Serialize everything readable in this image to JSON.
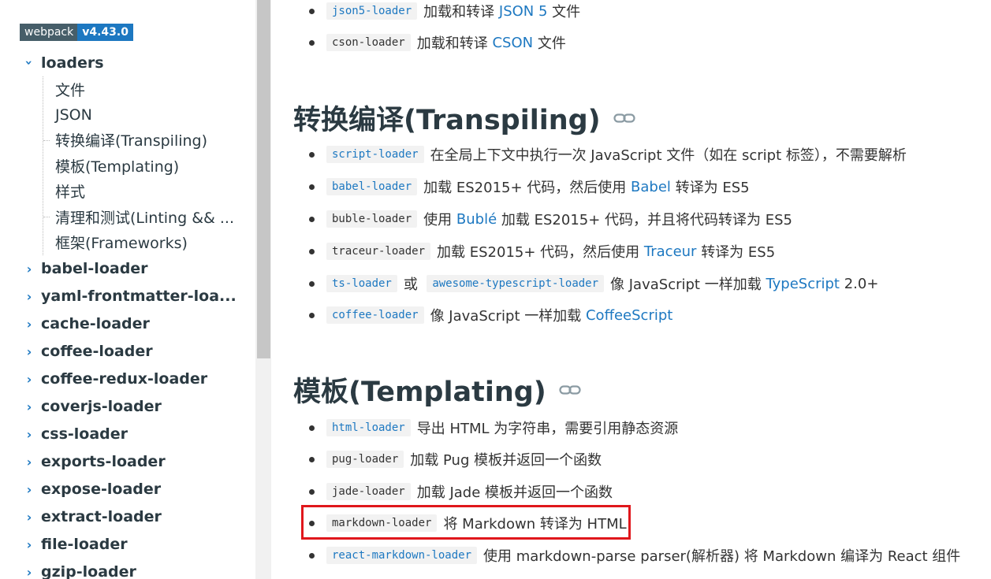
{
  "sidebar": {
    "badge": {
      "name": "webpack",
      "version": "v4.43.0"
    },
    "expanded": {
      "label": "loaders",
      "children": [
        "文件",
        "JSON",
        "转换编译(Transpiling)",
        "模板(Templating)",
        "样式",
        "清理和测试(Linting && ...",
        "框架(Frameworks)"
      ]
    },
    "items": [
      "babel-loader",
      "yaml-frontmatter-loa...",
      "cache-loader",
      "coffee-loader",
      "coffee-redux-loader",
      "coverjs-loader",
      "css-loader",
      "exports-loader",
      "expose-loader",
      "extract-loader",
      "file-loader",
      "gzip-loader"
    ]
  },
  "content": {
    "top_bullets": [
      {
        "code": "json5-loader",
        "pre": "加载和转译",
        "link": "JSON 5",
        "post": "文件"
      },
      {
        "code": "cson-loader",
        "pre": "加载和转译",
        "link": "CSON",
        "post": "文件"
      }
    ],
    "transpiling": {
      "title": "转换编译(Transpiling)",
      "items": {
        "script": {
          "code": "script-loader",
          "text": "在全局上下文中执行一次 JavaScript 文件（如在 script 标签），不需要解析"
        },
        "babel": {
          "code": "babel-loader",
          "pre": "加载 ES2015+ 代码，然后使用",
          "link": "Babel",
          "post": "转译为 ES5"
        },
        "buble": {
          "code": "buble-loader",
          "pre": "使用",
          "link": "Bublé",
          "post": "加载 ES2015+ 代码，并且将代码转译为 ES5"
        },
        "traceur": {
          "code": "traceur-loader",
          "pre": "加载 ES2015+ 代码，然后使用",
          "link": "Traceur",
          "post": "转译为 ES5"
        },
        "ts": {
          "code": "ts-loader",
          "or": "或",
          "code2": "awesome-typescript-loader",
          "pre": "像 JavaScript 一样加载",
          "link": "TypeScript",
          "post": "2.0+"
        },
        "coffee": {
          "code": "coffee-loader",
          "pre": "像 JavaScript 一样加载",
          "link": "CoffeeScript"
        }
      }
    },
    "templating": {
      "title": "模板(Templating)",
      "items": {
        "html": {
          "code": "html-loader",
          "text": "导出 HTML 为字符串，需要引用静态资源"
        },
        "pug": {
          "code": "pug-loader",
          "text": "加载 Pug 模板并返回一个函数"
        },
        "jade": {
          "code": "jade-loader",
          "text": "加载 Jade 模板并返回一个函数"
        },
        "markdown": {
          "code": "markdown-loader",
          "text": "将 Markdown 转译为 HTML"
        },
        "react_markdown": {
          "code": "react-markdown-loader",
          "text": "使用 markdown-parse parser(解析器) 将 Markdown 编译为 React 组件"
        }
      }
    }
  },
  "colors": {
    "link": "#1d78c1",
    "highlight": "#e0171c",
    "heading": "#2b3a42"
  }
}
